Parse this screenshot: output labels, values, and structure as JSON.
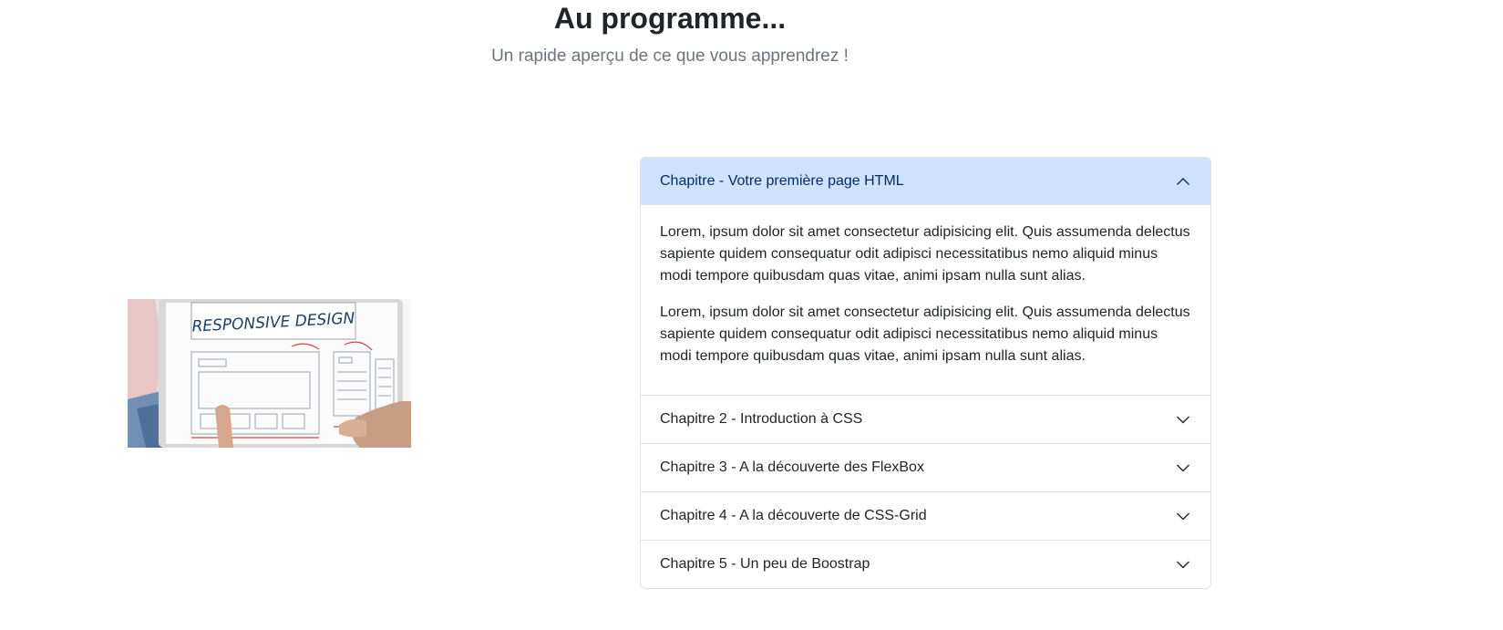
{
  "section": {
    "title": "Au programme...",
    "subtitle": "Un rapide aperçu de ce que vous apprendrez !"
  },
  "image": {
    "headline": "RESPONSIVE DESIGN"
  },
  "accordion": {
    "items": [
      {
        "label": "Chapitre - Votre première page HTML",
        "expanded": true,
        "paragraphs": [
          "Lorem, ipsum dolor sit amet consectetur adipisicing elit. Quis assumenda delectus sapiente quidem consequatur odit adipisci necessitatibus nemo aliquid minus modi tempore quibusdam quas vitae, animi ipsam nulla sunt alias.",
          "Lorem, ipsum dolor sit amet consectetur adipisicing elit. Quis assumenda delectus sapiente quidem consequatur odit adipisci necessitatibus nemo aliquid minus modi tempore quibusdam quas vitae, animi ipsam nulla sunt alias."
        ]
      },
      {
        "label": "Chapitre 2 - Introduction à CSS",
        "expanded": false
      },
      {
        "label": "Chapitre 3 - A la découverte des FlexBox",
        "expanded": false
      },
      {
        "label": "Chapitre 4 - A la découverte de CSS-Grid",
        "expanded": false
      },
      {
        "label": "Chapitre 5 - Un peu de Boostrap",
        "expanded": false
      }
    ],
    "chevron_up_icon": "chevron-up-icon",
    "chevron_down_icon": "chevron-down-icon"
  },
  "colors": {
    "active_header_bg": "#cfe2ff",
    "active_header_text": "#052c65",
    "border": "#dee2e6",
    "subtitle": "#6c757d"
  }
}
